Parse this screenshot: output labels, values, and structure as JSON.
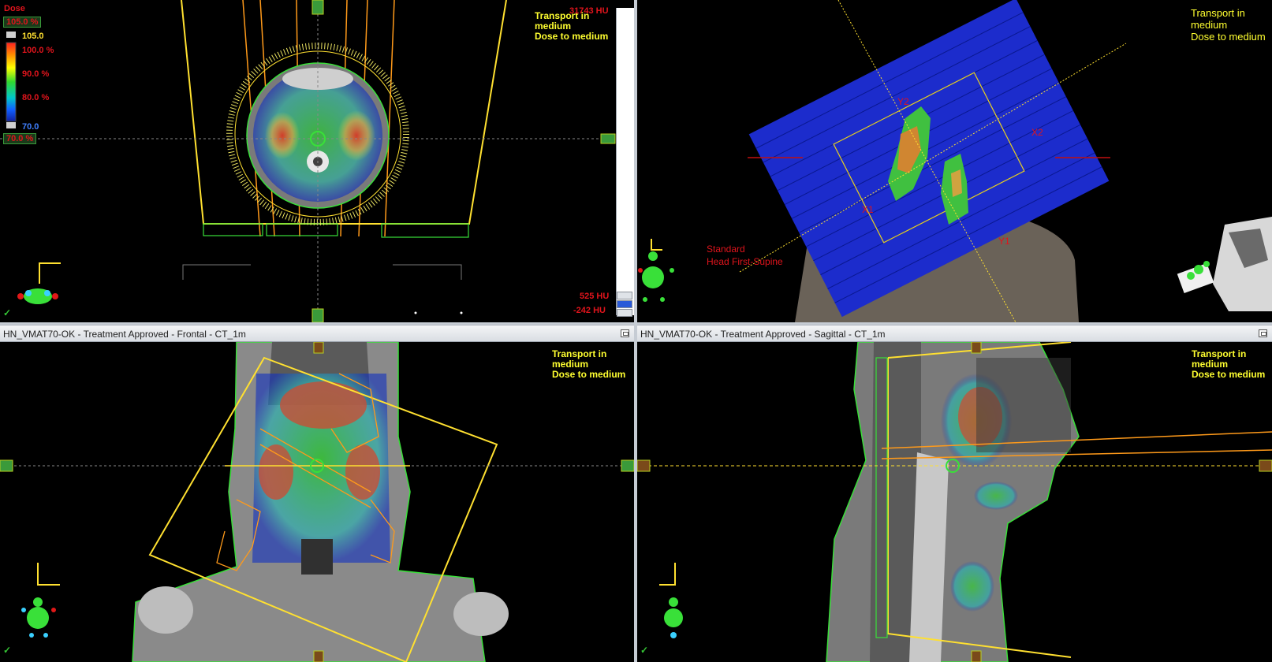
{
  "legend": {
    "title": "Dose",
    "max_box": "105.0 %",
    "max_value": "105.0",
    "ticks": [
      "100.0 %",
      "90.0 %",
      "80.0 %"
    ],
    "min_value": "70.0",
    "min_box": "70.0 %"
  },
  "calc_info": {
    "line1": "Transport in",
    "line2": "medium",
    "line3": "Dose to medium"
  },
  "hu": {
    "top": "31743 HU",
    "mid": "525 HU",
    "bottom": "-242 HU"
  },
  "orientation": {
    "line1": "Standard",
    "line2": "Head First-Supine"
  },
  "bev_labels": {
    "y2": "Y2",
    "x2": "X2",
    "x1": "X1",
    "y1": "Y1"
  },
  "views": {
    "frontal_title": "HN_VMAT70-OK  -  Treatment Approved - Frontal - CT_1m",
    "sagittal_title": "HN_VMAT70-OK  -  Treatment Approved - Sagittal - CT_1m"
  },
  "checkmark": "✓",
  "colors": {
    "accent_yellow": "#ffff30",
    "label_red": "#e0141c",
    "outline_green": "#39e039",
    "field_blue": "#1c2ccc",
    "beam_orange": "#ff9a1a"
  }
}
